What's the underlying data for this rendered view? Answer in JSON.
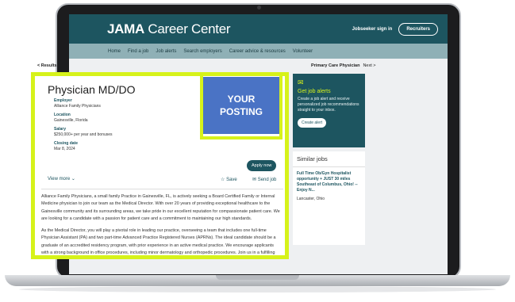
{
  "header": {
    "logo_bold": "JAMA",
    "logo_rest": " Career Center",
    "signin": "Jobseeker sign in",
    "recruiters": "Recruiters"
  },
  "nav": [
    "Home",
    "Find a job",
    "Job alerts",
    "Search employers",
    "Career advice & resources",
    "Volunteer"
  ],
  "toolbar": {
    "back": "< Results",
    "breadcrumb": "Primary Care Physician",
    "next": "Next >"
  },
  "job": {
    "title": "Physician MD/DO",
    "employer_label": "Employer",
    "employer": "Alliance Family Physicians",
    "location_label": "Location",
    "location": "Gainesville, Florida",
    "salary_label": "Salary",
    "salary": "$250,000+ per year and bonuses",
    "closing_label": "Closing date",
    "closing": "Mar 8, 2024",
    "apply": "Apply now",
    "view_more": "View more",
    "save": "Save",
    "send": "Send job",
    "posting_line1": "YOUR",
    "posting_line2": "POSTING",
    "desc1": "Alliance Family Physicians, a small family Practice in Gainesville, FL, is actively seeking a Board Certified Family or Internal Medicine physician to join our team as the Medical Director. With over 20 years of providing exceptional healthcare to the Gainesville community and its surrounding areas, we take pride in our excellent reputation for compassionate patient care. We are looking for a candidate with a passion for patient care and a commitment to maintaining our high standards.",
    "desc2": "As the Medical Director, you will play a pivotal role in leading our practice, overseeing a team that includes one full-time Physician Assistant (PA) and two part-time Advanced Practice Registered Nurses (APRNs). The ideal candidate should be a graduate of an accredited residency program, with prior experience in an active medical practice. We encourage applicants with a strong background in office procedures, including minor dermatology and orthopedic procedures. Join us in a fulfilling role where you can"
  },
  "alerts": {
    "title": "Get job alerts",
    "text": "Create a job alert and receive personalized job recommendations straight to your inbox.",
    "button": "Create alert"
  },
  "similar": {
    "title": "Similar jobs",
    "job_title": "Full Time Ob/Gyn Hospitalist opportunity + JUST 30 miles Southeast of Columbus, Ohio! -- Enjoy N...",
    "job_location": "Lancaster, Ohio"
  },
  "colors": {
    "brand": "#1d5560",
    "highlight": "#d6f21a",
    "posting": "#4a73c5"
  }
}
